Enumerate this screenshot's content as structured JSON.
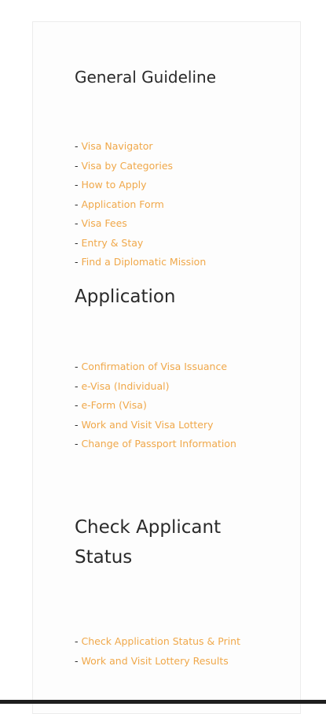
{
  "sections": [
    {
      "title": "General Guideline",
      "links": [
        "Visa Navigator",
        "Visa by Categories",
        "How to Apply",
        "Application Form",
        "Visa Fees",
        "Entry & Stay",
        "Find a Diplomatic Mission"
      ]
    },
    {
      "title": "Application",
      "links": [
        "Confirmation of Visa Issuance",
        "e-Visa (Individual)",
        "e-Form (Visa)",
        "Work and Visit Visa Lottery",
        "Change of Passport Information"
      ]
    },
    {
      "title": "Check Applicant Status",
      "links": [
        "Check Application Status & Print",
        "Work and Visit Lottery Results"
      ]
    }
  ],
  "link_prefix": "- ",
  "colors": {
    "link": "#f0a84a",
    "heading": "#2a2a2a"
  }
}
